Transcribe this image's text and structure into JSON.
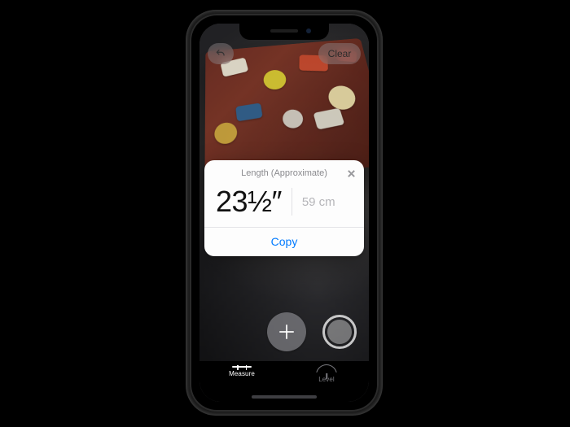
{
  "topbar": {
    "undo_name": "undo",
    "clear_label": "Clear"
  },
  "popup": {
    "title": "Length (Approximate)",
    "primary": "23½″",
    "secondary": "59 cm",
    "action": "Copy"
  },
  "controls": {
    "add_name": "add-point",
    "shutter_name": "capture"
  },
  "tabs": {
    "measure": "Measure",
    "level": "Level",
    "active": "measure"
  },
  "colors": {
    "accent": "#007aff"
  }
}
